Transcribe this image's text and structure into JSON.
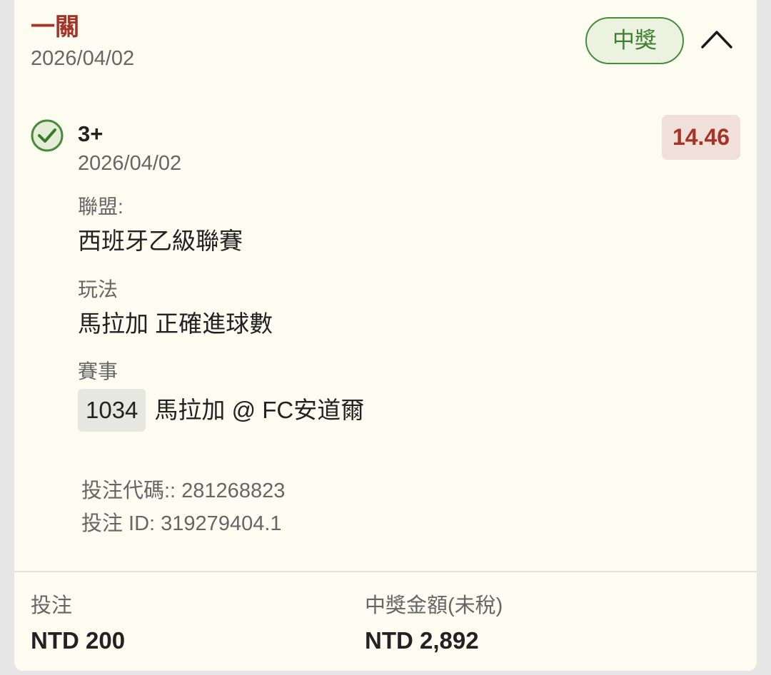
{
  "header": {
    "ticket_type": "一關",
    "date": "2026/04/02",
    "status": "中獎"
  },
  "selection": {
    "pick": "3+",
    "date": "2026/04/02",
    "odds": "14.46",
    "league_label": "聯盟:",
    "league": "西班牙乙級聯賽",
    "market_label": "玩法",
    "market": "馬拉加 正確進球數",
    "event_label": "賽事",
    "event_number": "1034",
    "event_name": "馬拉加 @ FC安道爾"
  },
  "meta": {
    "bet_code": "投注代碼:: 281268823",
    "bet_id": "投注 ID: 319279404.1"
  },
  "footer": {
    "stake_label": "投注",
    "stake_value": "NTD 200",
    "payout_label": "中獎金額(未稅)",
    "payout_value": "NTD 2,892"
  },
  "colors": {
    "accent_red": "#a63327",
    "win_green": "#3f7f31",
    "card_background": "#fcfcf0"
  },
  "icons": {
    "collapse": "chevron-up-icon",
    "result": "check-circle-icon"
  }
}
